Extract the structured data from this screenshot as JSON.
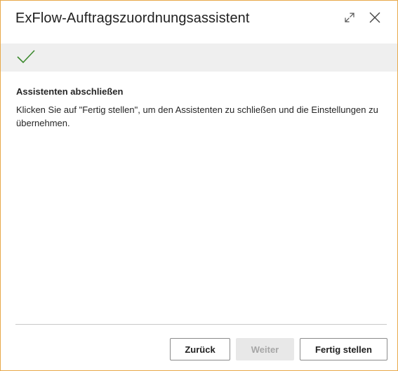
{
  "dialog": {
    "title": "ExFlow-Auftragszuordnungsassistent",
    "icons": {
      "expand": "expand-icon",
      "close": "close-icon"
    }
  },
  "banner": {
    "icon": "checkmark-icon",
    "color": "#3c8a2e"
  },
  "content": {
    "heading": "Assistenten abschließen",
    "body": "Klicken Sie auf \"Fertig stellen\", um den Assistenten zu schließen und die Einstellungen zu übernehmen."
  },
  "buttons": {
    "back_label": "Zurück",
    "next_label": "Weiter",
    "finish_label": "Fertig stellen"
  }
}
